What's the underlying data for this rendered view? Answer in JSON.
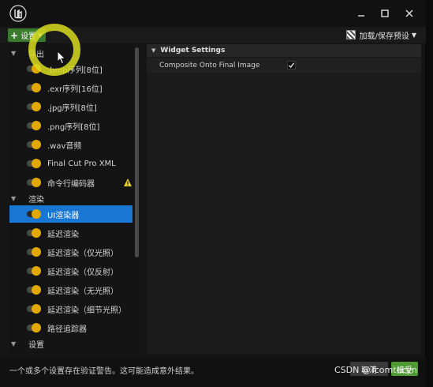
{
  "window": {
    "logo_icon": "unreal-engine-logo-icon",
    "controls": [
      "minimize-icon",
      "maximize-icon",
      "close-icon"
    ]
  },
  "toolbar": {
    "settings_label": "设置",
    "preset_label": "加载/保存预设"
  },
  "left_panel": {
    "categories": [
      {
        "label": "导出",
        "expanded": true
      },
      {
        "label": "渲染",
        "expanded": true
      },
      {
        "label": "设置",
        "expanded": true
      }
    ],
    "export_items": [
      {
        "label": ".bmp序列[8位]",
        "enabled": true
      },
      {
        "label": ".exr序列[16位]",
        "enabled": true
      },
      {
        "label": ".jpg序列[8位]",
        "enabled": true
      },
      {
        "label": ".png序列[8位]",
        "enabled": true
      },
      {
        "label": ".wav音频",
        "enabled": true
      },
      {
        "label": "Final Cut Pro XML",
        "enabled": true
      },
      {
        "label": "命令行编码器",
        "enabled": true,
        "warning": true
      }
    ],
    "render_items": [
      {
        "label": "UI渲染器",
        "enabled": true,
        "selected": true
      },
      {
        "label": "延迟渲染",
        "enabled": true
      },
      {
        "label": "延迟渲染（仅光照）",
        "enabled": true
      },
      {
        "label": "延迟渲染（仅反射）",
        "enabled": true
      },
      {
        "label": "延迟渲染（无光照）",
        "enabled": true
      },
      {
        "label": "延迟渲染（细节光照）",
        "enabled": true
      },
      {
        "label": "路径追踪器",
        "enabled": true
      }
    ]
  },
  "right_panel": {
    "section_title": "Widget Settings",
    "properties": [
      {
        "label": "Composite Onto Final Image",
        "checked": true
      }
    ]
  },
  "footer": {
    "message": "一个或多个设置存在验证警告。这可能造成意外结果。",
    "cancel_label": "取消",
    "accept_label": "接受"
  },
  "watermark": "CSDN @Tcomtecyn",
  "colors": {
    "accent_selected": "#1976d2",
    "settings_button": "#3a7a2c",
    "accept_button": "#4f9a33",
    "toggle_knob": "#e0a800",
    "highlight_ring": "#d8dc1e"
  }
}
